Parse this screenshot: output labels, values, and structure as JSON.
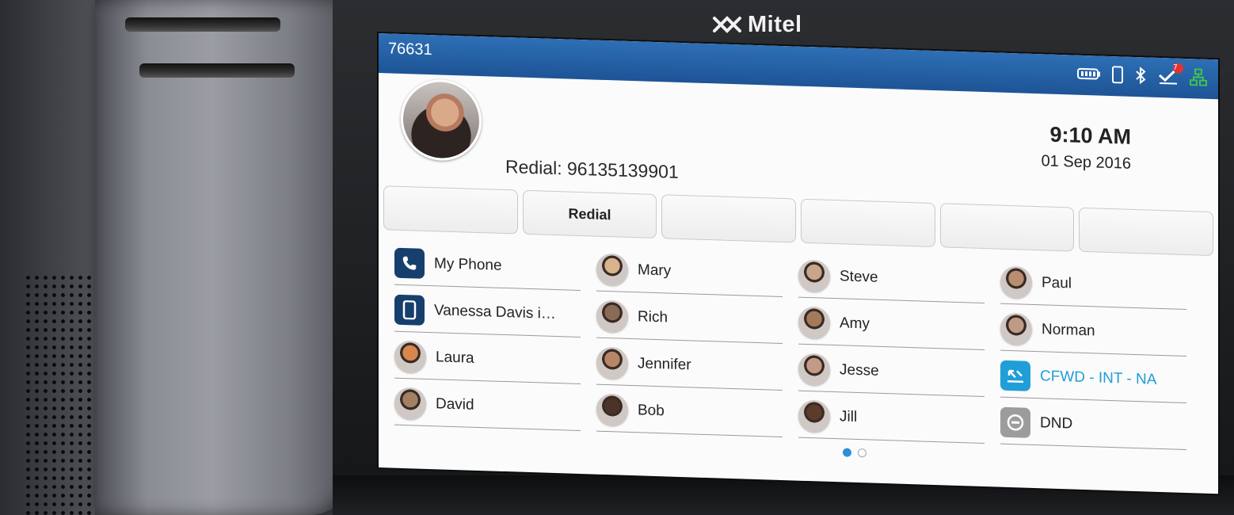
{
  "device": {
    "brand": "Mitel"
  },
  "status_bar": {
    "extension": "76631",
    "icons": [
      "battery-icon",
      "mobile-phone-icon",
      "bluetooth-icon",
      "voicemail-icon",
      "network-icon"
    ],
    "voicemail_count": "7"
  },
  "header": {
    "redial_text": "Redial: 96135139901",
    "time": "9:10 AM",
    "date": "01 Sep 2016"
  },
  "softkeys": [
    "",
    "Redial",
    "",
    "",
    "",
    ""
  ],
  "contacts": [
    {
      "label": "My Phone",
      "kind": "icon",
      "icon": "phone-icon",
      "color": "#163f6e"
    },
    {
      "label": "Mary",
      "kind": "face",
      "color": "#d9b38c"
    },
    {
      "label": "Steve",
      "kind": "face",
      "color": "#c9a58e"
    },
    {
      "label": "Paul",
      "kind": "face",
      "color": "#b98d6f"
    },
    {
      "label": "Vanessa Davis i…",
      "kind": "icon",
      "icon": "mobile-icon",
      "color": "#163f6e"
    },
    {
      "label": "Rich",
      "kind": "face",
      "color": "#8a6b58"
    },
    {
      "label": "Amy",
      "kind": "face",
      "color": "#a57a5c"
    },
    {
      "label": "Norman",
      "kind": "face",
      "color": "#bf9a84"
    },
    {
      "label": "Laura",
      "kind": "face",
      "color": "#d7864e"
    },
    {
      "label": "Jennifer",
      "kind": "face",
      "color": "#b58668"
    },
    {
      "label": "Jesse",
      "kind": "face",
      "color": "#c29a86"
    },
    {
      "label": "CFWD - INT - NA",
      "kind": "icon",
      "icon": "call-forward-icon",
      "color": "#1f9ed8",
      "accent": true
    },
    {
      "label": "David",
      "kind": "face",
      "color": "#a28063"
    },
    {
      "label": "Bob",
      "kind": "face",
      "color": "#4a3328"
    },
    {
      "label": "Jill",
      "kind": "face",
      "color": "#5a3b2c"
    },
    {
      "label": "DND",
      "kind": "icon",
      "icon": "do-not-disturb-icon",
      "color": "#9c9c9c"
    }
  ],
  "pager": {
    "pages": 2,
    "current": 1
  }
}
